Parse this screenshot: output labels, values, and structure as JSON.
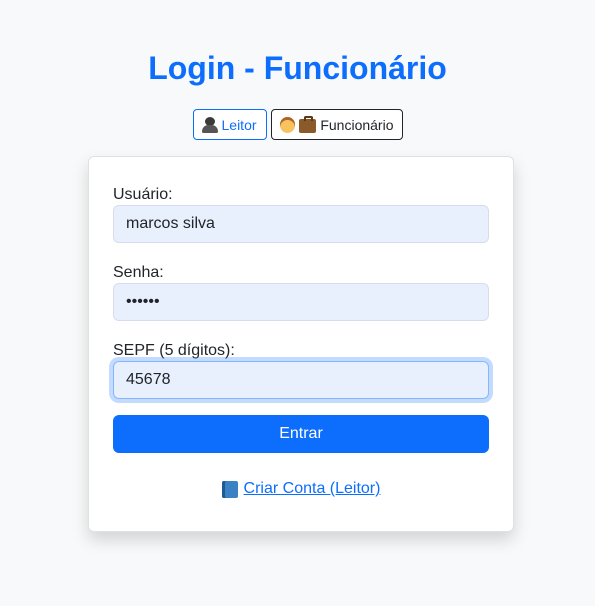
{
  "header": {
    "title": "Login - Funcionário"
  },
  "role_switch": {
    "reader_label": "Leitor",
    "employee_label": "Funcionário",
    "active": "employee"
  },
  "form": {
    "username": {
      "label": "Usuário:",
      "value": "marcos silva"
    },
    "password": {
      "label": "Senha:",
      "value": "••••••"
    },
    "sepf": {
      "label": "SEPF (5 dígitos):",
      "value": "45678"
    },
    "submit_label": "Entrar"
  },
  "footer": {
    "register_link": "Criar Conta (Leitor)"
  },
  "colors": {
    "primary": "#0d6efd",
    "background": "#f8f9fa",
    "input_fill": "#e8f0fe"
  }
}
